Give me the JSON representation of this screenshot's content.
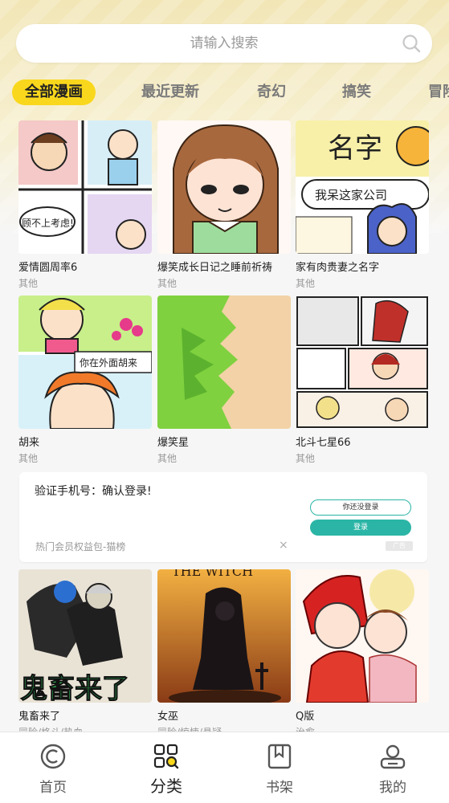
{
  "search": {
    "placeholder": "请输入搜索"
  },
  "tabs": [
    {
      "label": "全部漫画",
      "active": true
    },
    {
      "label": "最近更新",
      "active": false
    },
    {
      "label": "奇幻",
      "active": false
    },
    {
      "label": "搞笑",
      "active": false
    },
    {
      "label": "冒险",
      "active": false
    }
  ],
  "comics": [
    {
      "title": "爱情圆周率6",
      "genre": "其他",
      "cover_text": "顾不上考虑!"
    },
    {
      "title": "爆笑成长日记之睡前祈祷",
      "genre": "其他"
    },
    {
      "title": "家有肉贵妻之名字",
      "genre": "其他",
      "cover_text": "名字",
      "cover_text2": "我呆这家公司"
    },
    {
      "title": "胡来",
      "genre": "其他",
      "cover_text": "你在外面胡来"
    },
    {
      "title": "爆笑星",
      "genre": "其他"
    },
    {
      "title": "北斗七星66",
      "genre": "其他"
    }
  ],
  "ad": {
    "title": "验证手机号：确认登录!",
    "subtitle": "热门会员权益包-猫榜",
    "close_icon": "×",
    "btn1": "你还没登录",
    "btn2": "登录",
    "tag": "广告"
  },
  "comics2": [
    {
      "title": "鬼畜来了",
      "genre": "冒险/格斗/热血",
      "cover_text": "鬼畜来了"
    },
    {
      "title": "女巫",
      "genre": "冒险/惊悚/悬疑",
      "cover_text": "THE WITCH"
    },
    {
      "title": "Q版",
      "genre": "治愈"
    }
  ],
  "nav": [
    {
      "label": "首页",
      "icon": "home-icon"
    },
    {
      "label": "分类",
      "icon": "category-icon",
      "active": true
    },
    {
      "label": "书架",
      "icon": "bookshelf-icon"
    },
    {
      "label": "我的",
      "icon": "profile-icon"
    }
  ]
}
